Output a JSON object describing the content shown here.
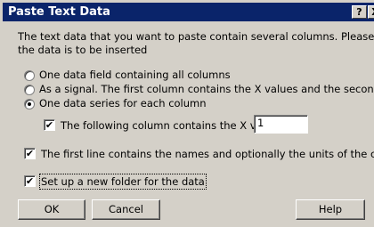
{
  "dialog": {
    "title": "Paste Text Data",
    "help_glyph": "?",
    "close_glyph": "X",
    "description_line1": "The text data that you want to paste contain several columns. Please specify how",
    "description_line2": "the data is to be inserted",
    "options": [
      {
        "label": "One data field containing all columns",
        "selected": false
      },
      {
        "label": "As a signal. The first column contains the X values and the second the Y values",
        "selected": false
      },
      {
        "label": "One data series for each column",
        "selected": true
      }
    ],
    "x_column": {
      "label": "The following column contains the X values:",
      "checked": true,
      "value": "1"
    },
    "first_line": {
      "label": "The first line contains the names and optionally the units of the columns",
      "checked": true
    },
    "new_folder": {
      "label": "Set up a new folder for the data",
      "checked": true
    },
    "buttons": {
      "ok": "OK",
      "cancel": "Cancel",
      "help": "Help"
    },
    "check_glyph": "✔"
  }
}
